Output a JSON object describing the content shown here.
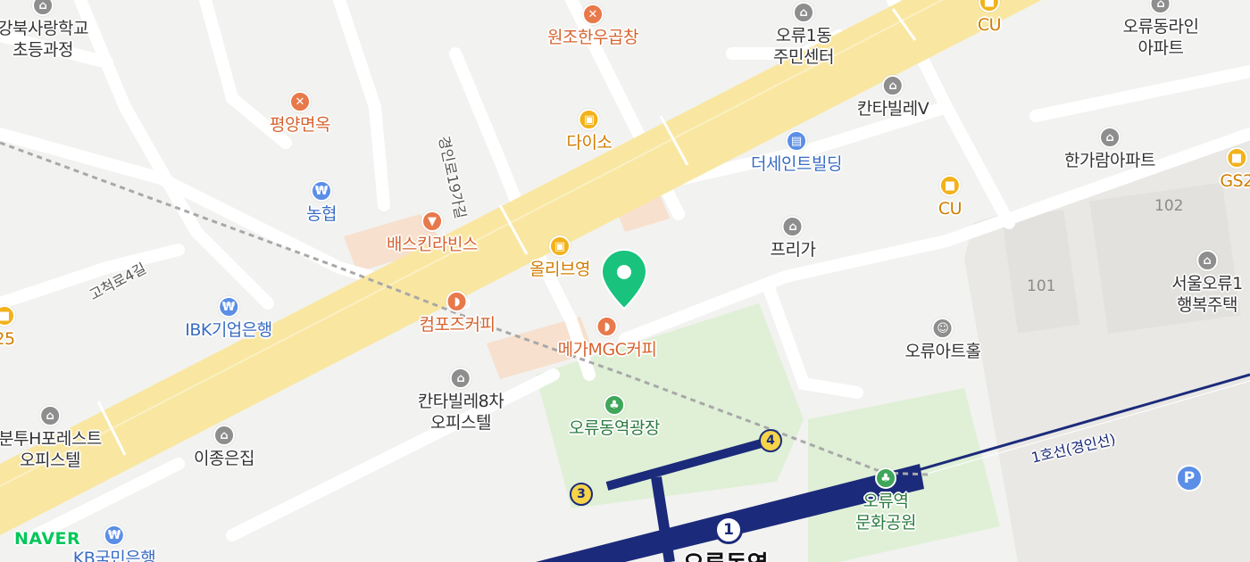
{
  "watermark": "NAVER",
  "pois": [
    {
      "key": "school",
      "label": "강북사랑학교\n초등과정",
      "cat": "bldg",
      "icon": "school-icon"
    },
    {
      "key": "wonjo",
      "label": "원조한우곱창",
      "cat": "food",
      "icon": "restaurant-icon"
    },
    {
      "key": "community",
      "label": "오류1동\n주민센터",
      "cat": "bldg",
      "icon": "building-icon"
    },
    {
      "key": "cu1",
      "label": "CU",
      "cat": "shop",
      "icon": "convenience-store-icon"
    },
    {
      "key": "oryu-line",
      "label": "오류동라인\n아파트",
      "cat": "bldg",
      "icon": "apartment-icon"
    },
    {
      "key": "pyongyang",
      "label": "평양면옥",
      "cat": "food",
      "icon": "restaurant-icon"
    },
    {
      "key": "daiso",
      "label": "다이소",
      "cat": "shop",
      "icon": "shopping-icon"
    },
    {
      "key": "kantavill-v",
      "label": "칸타빌레V",
      "cat": "bldg",
      "icon": "building-icon"
    },
    {
      "key": "hangaram",
      "label": "한가람아파트",
      "cat": "bldg",
      "icon": "apartment-icon"
    },
    {
      "key": "the-saint",
      "label": "더세인트빌딩",
      "cat": "bank",
      "icon": "office-icon"
    },
    {
      "key": "gs25",
      "label": "GS2",
      "cat": "shop",
      "icon": "convenience-store-icon"
    },
    {
      "key": "nonghyup",
      "label": "농협",
      "cat": "bank",
      "icon": "bank-icon"
    },
    {
      "key": "cu2",
      "label": "CU",
      "cat": "shop",
      "icon": "convenience-store-icon"
    },
    {
      "key": "baskin",
      "label": "배스킨라빈스",
      "cat": "food",
      "icon": "ice-cream-icon"
    },
    {
      "key": "olive",
      "label": "올리브영",
      "cat": "shop",
      "icon": "shopping-icon"
    },
    {
      "key": "prigah",
      "label": "프리가",
      "cat": "bldg",
      "icon": "building-icon"
    },
    {
      "key": "seoul-oryu",
      "label": "서울오류1\n행복주택",
      "cat": "bldg",
      "icon": "apartment-icon"
    },
    {
      "key": "gs25-left",
      "label": "25",
      "cat": "shop",
      "icon": "convenience-store-icon"
    },
    {
      "key": "compose",
      "label": "컴포즈커피",
      "cat": "food",
      "icon": "cafe-icon"
    },
    {
      "key": "ibk",
      "label": "IBK기업은행",
      "cat": "bank",
      "icon": "bank-icon"
    },
    {
      "key": "mega",
      "label": "메가MGC커피",
      "cat": "food",
      "icon": "cafe-icon"
    },
    {
      "key": "arthall",
      "label": "오류아트홀",
      "cat": "bldg",
      "icon": "theater-icon"
    },
    {
      "key": "kantavill-8",
      "label": "칸타빌레8차\n오피스텔",
      "cat": "bldg",
      "icon": "building-icon"
    },
    {
      "key": "plaza",
      "label": "오류동역광장",
      "cat": "park",
      "icon": "park-icon"
    },
    {
      "key": "hforest",
      "label": "분투H포레스트\n오피스텔",
      "cat": "bldg",
      "icon": "building-icon"
    },
    {
      "key": "leejong",
      "label": "이종은집",
      "cat": "bldg",
      "icon": "house-icon"
    },
    {
      "key": "culture-park",
      "label": "오류역\n문화공원",
      "cat": "park",
      "icon": "park-icon"
    },
    {
      "key": "kb",
      "label": "KB국민은행",
      "cat": "bank",
      "icon": "bank-icon"
    }
  ],
  "roads": [
    {
      "key": "gyeongin19",
      "label": "경인로19가길"
    },
    {
      "key": "gocheok4",
      "label": "고척로4길"
    }
  ],
  "building_numbers": [
    "102",
    "101"
  ],
  "subway": {
    "line_label": "1호선(경인선)",
    "line_color": "#1b2a7a",
    "station_number": "1",
    "station_name": "오류동역",
    "exits": [
      "4",
      "3"
    ]
  },
  "parking_label": "P",
  "pin_color": "#19c37d",
  "colors": {
    "main_road": "#f9e7a1",
    "park": "#dff0d6",
    "commercial": "#f7e0cd",
    "rail_bed": "#ecebe8"
  }
}
